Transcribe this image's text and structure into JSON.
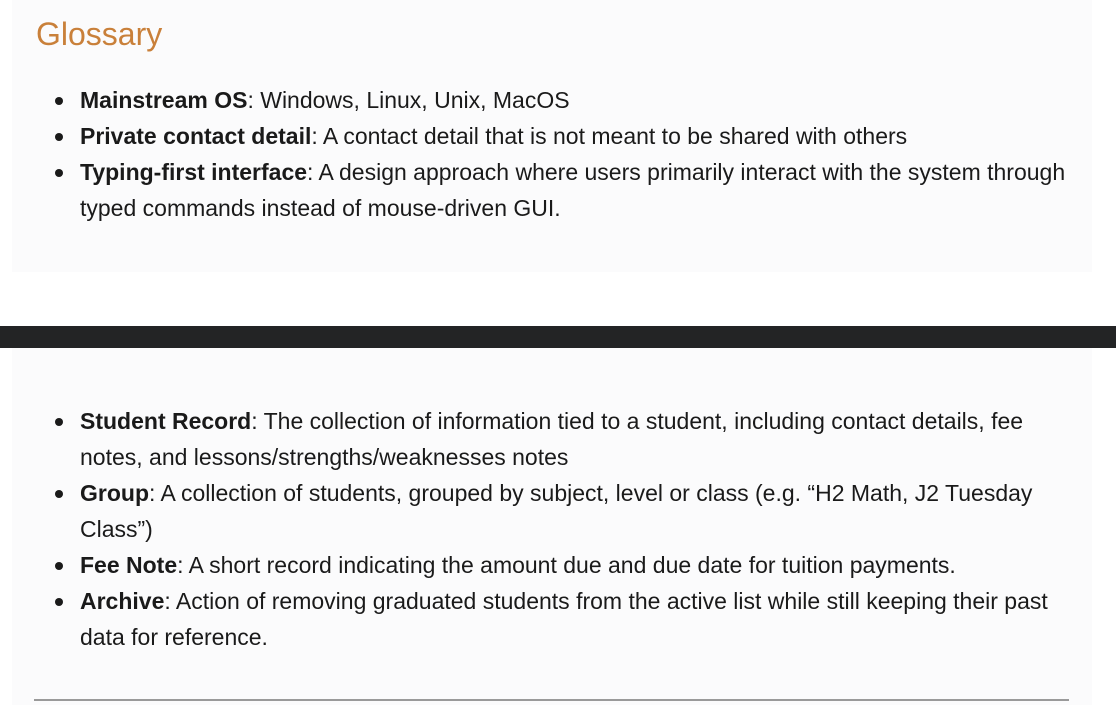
{
  "glossary": {
    "title": "Glossary",
    "items_top": [
      {
        "term": "Mainstream OS",
        "definition": ": Windows, Linux, Unix, MacOS"
      },
      {
        "term": "Private contact detail",
        "definition": ": A contact detail that is not meant to be shared with others"
      },
      {
        "term": "Typing-first interface",
        "definition": ": A design approach where users primarily interact with the system through typed commands instead of mouse-driven GUI."
      }
    ],
    "items_bottom": [
      {
        "term": "Student Record",
        "definition": ": The collection of information tied to a student, including contact details, fee notes, and lessons/strengths/weaknesses notes"
      },
      {
        "term": "Group",
        "definition": ": A collection of students, grouped by subject, level or class (e.g. “H2 Math, J2 Tuesday Class”)"
      },
      {
        "term": "Fee Note",
        "definition": ": A short record indicating the amount due and due date for tuition payments."
      },
      {
        "term": "Archive",
        "definition": ": Action of removing graduated students from the active list while still keeping their past data for reference."
      }
    ]
  },
  "colors": {
    "heading": "#c9803a",
    "divider_bar": "#232425",
    "panel": "#fbfbfc"
  }
}
